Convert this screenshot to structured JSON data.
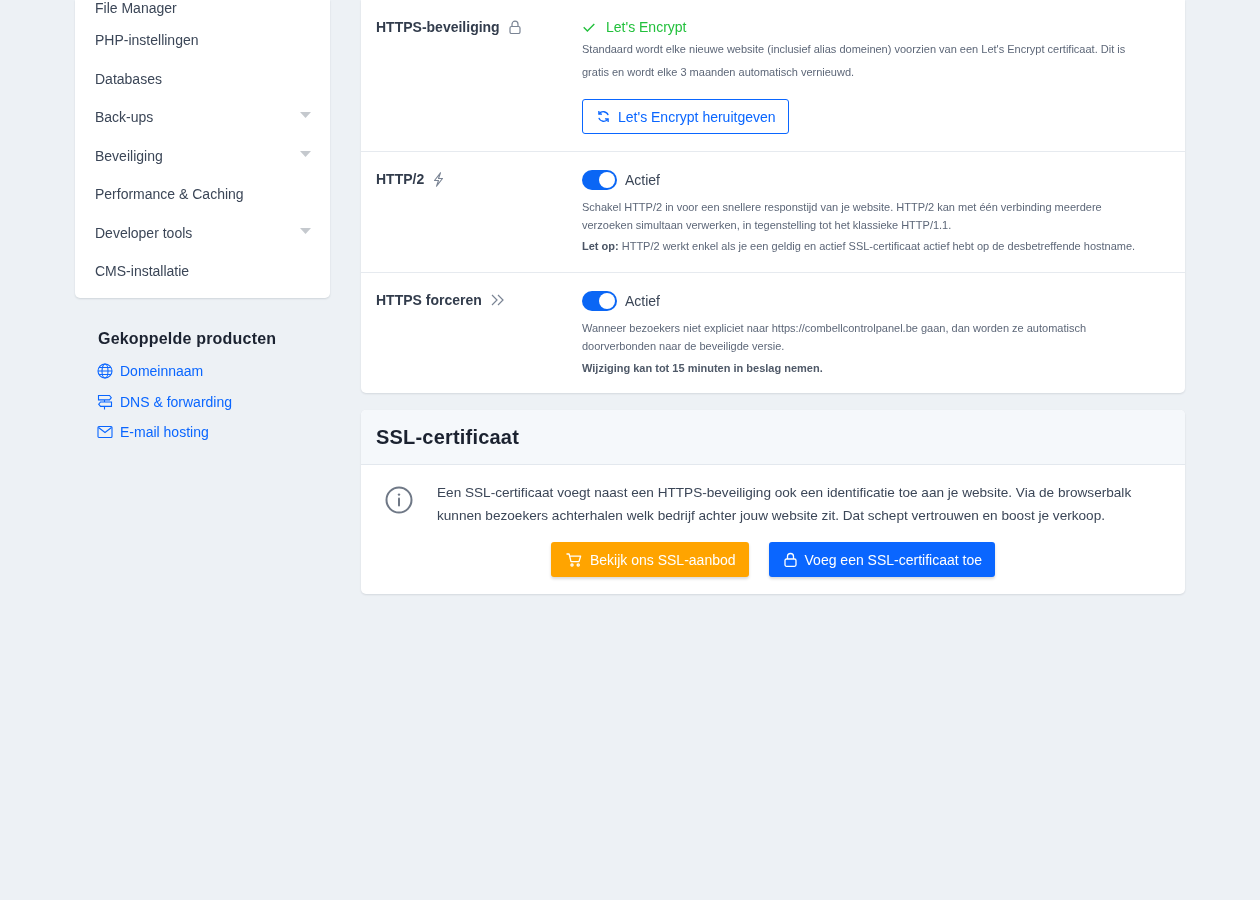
{
  "sidebar": {
    "menu": [
      {
        "label": "File Manager",
        "kind": "link"
      },
      {
        "label": "PHP-instellingen",
        "kind": "link"
      },
      {
        "label": "Databases",
        "kind": "link"
      },
      {
        "label": "Back-ups",
        "kind": "submenu"
      },
      {
        "label": "Beveiliging",
        "kind": "submenu"
      },
      {
        "label": "Performance & Caching",
        "kind": "link"
      },
      {
        "label": "Developer tools",
        "kind": "submenu"
      },
      {
        "label": "CMS-installatie",
        "kind": "link"
      }
    ]
  },
  "linked_products": {
    "title": "Gekoppelde producten",
    "links": [
      {
        "label": "Domeinnaam",
        "kind": "domain"
      },
      {
        "label": "DNS & forwarding",
        "kind": "dns"
      },
      {
        "label": "E-mail hosting",
        "kind": "mail"
      }
    ]
  },
  "settings": {
    "rows": [
      {
        "kind": "certificate",
        "label": "HTTPS-beveiliging",
        "status": "Let's Encrypt",
        "description": "Standaard wordt elke nieuwe website (inclusief alias domeinen) voorzien van een Let's Encrypt certificaat. Dit is gratis en wordt elke 3 maanden automatisch vernieuwd.",
        "button": "Let's Encrypt heruitgeven"
      },
      {
        "kind": "toggle",
        "label": "HTTP/2",
        "on": true,
        "toggle_label": "Actief",
        "description": "Schakel HTTP/2 in voor een snellere responstijd van je website. HTTP/2 kan met één verbinding meerdere verzoeken simultaan verwerken, in tegenstelling tot het klassieke HTTP/1.1.",
        "warning": "**Let op:** HTTP/2 werkt enkel als je een geldig en actief SSL-certificaat actief hebt op de desbetreffende hostname."
      },
      {
        "kind": "toggle",
        "label": "HTTPS forceren",
        "on": true,
        "toggle_label": "Actief",
        "description": "Wanneer bezoekers niet expliciet naar https://combellcontrolpanel.be gaan, dan worden ze automatisch doorverbonden naar de beveiligde versie.",
        "notice": "Wijziging kan tot 15 minuten in beslag nemen."
      }
    ]
  },
  "ssl_certificate": {
    "title": "SSL-certificaat",
    "info": "Een SSL-certificaat voegt naast een HTTPS-beveiliging ook een identificatie toe aan je website. Via de browserbalk kunnen bezoekers achterhalen welk bedrijf achter jouw website zit. Dat schept vertrouwen en boost je verkoop.",
    "buttons": [
      {
        "label": "Bekijk ons SSL-aanbod",
        "kind": "offer"
      },
      {
        "label": "Voeg een SSL-certificaat toe",
        "kind": "add"
      }
    ]
  }
}
